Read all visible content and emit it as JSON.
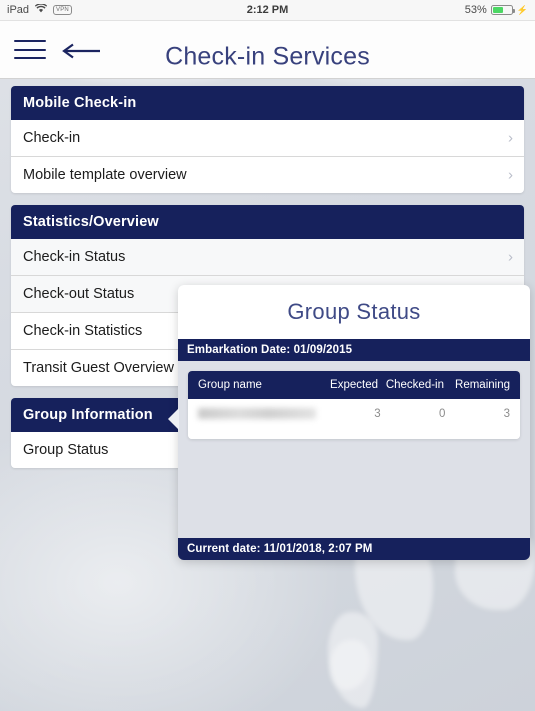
{
  "status_bar": {
    "device": "iPad",
    "wifi_icon": "wifi-icon",
    "vpn_label": "VPN",
    "time": "2:12 PM",
    "battery_percent": "53%",
    "battery_level": 53,
    "charging_icon": "lightning-bolt-icon"
  },
  "nav": {
    "menu_icon": "hamburger-menu-icon",
    "back_icon": "back-arrow-icon",
    "title": "Check-in Services"
  },
  "menu": {
    "sections": [
      {
        "header": "Mobile Check-in",
        "rows": [
          {
            "label": "Check-in",
            "chevron": "›"
          },
          {
            "label": "Mobile template overview",
            "chevron": "›"
          }
        ]
      },
      {
        "header": "Statistics/Overview",
        "rows": [
          {
            "label": "Check-in Status",
            "chevron": "›"
          },
          {
            "label": "Check-out Status",
            "chevron": "›"
          },
          {
            "label": "Check-in Statistics",
            "chevron": "›"
          },
          {
            "label": "Transit Guest Overview",
            "chevron": "›"
          }
        ]
      },
      {
        "header": "Group Information",
        "rows": [
          {
            "label": "Group Status",
            "chevron": "›"
          }
        ]
      }
    ]
  },
  "popover": {
    "title": "Group Status",
    "embarkation_line": "Embarkation Date:  01/09/2015",
    "table": {
      "columns": [
        "Group name",
        "Expected",
        "Checked-in",
        "Remaining"
      ],
      "rows": [
        {
          "group_name": "",
          "expected": "3",
          "checked_in": "0",
          "remaining": "3"
        }
      ]
    },
    "footer": "Current date: 11/01/2018, 2:07 PM"
  },
  "colors": {
    "navy": "#16215c",
    "title_blue": "#38417d",
    "battery_green": "#4cd764",
    "chevron_gray": "#b9bdc9"
  }
}
